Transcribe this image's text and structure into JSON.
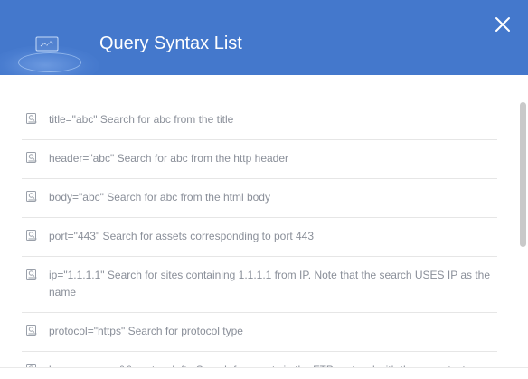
{
  "dialog": {
    "title": "Query Syntax List",
    "close_icon": "close-icon",
    "header_icon": "chart-emblem-icon",
    "colors": {
      "header": "#4478cc",
      "text": "#8a8f99",
      "divider": "#e6e6e6"
    }
  },
  "syntax_items": [
    {
      "text": "title=\"abc\" Search for abc from the title",
      "icon": "document-search-icon"
    },
    {
      "text": "header=\"abc\" Search for abc from the http header",
      "icon": "document-search-icon"
    },
    {
      "text": "body=\"abc\" Search for abc from the html body",
      "icon": "document-search-icon"
    },
    {
      "text": "port=\"443\" Search for assets corresponding to port 443",
      "icon": "document-search-icon"
    },
    {
      "text": "ip=\"1.1.1.1\" Search for sites containing 1.1.1.1 from IP. Note that the search USES IP as the name",
      "icon": "document-search-icon"
    },
    {
      "text": "protocol=\"https\" Search for protocol type",
      "icon": "document-search-icon"
    },
    {
      "text": "banner=users && protocol=ftp Search for assets in the FTP protocol with the users text",
      "icon": "document-search-icon"
    }
  ]
}
